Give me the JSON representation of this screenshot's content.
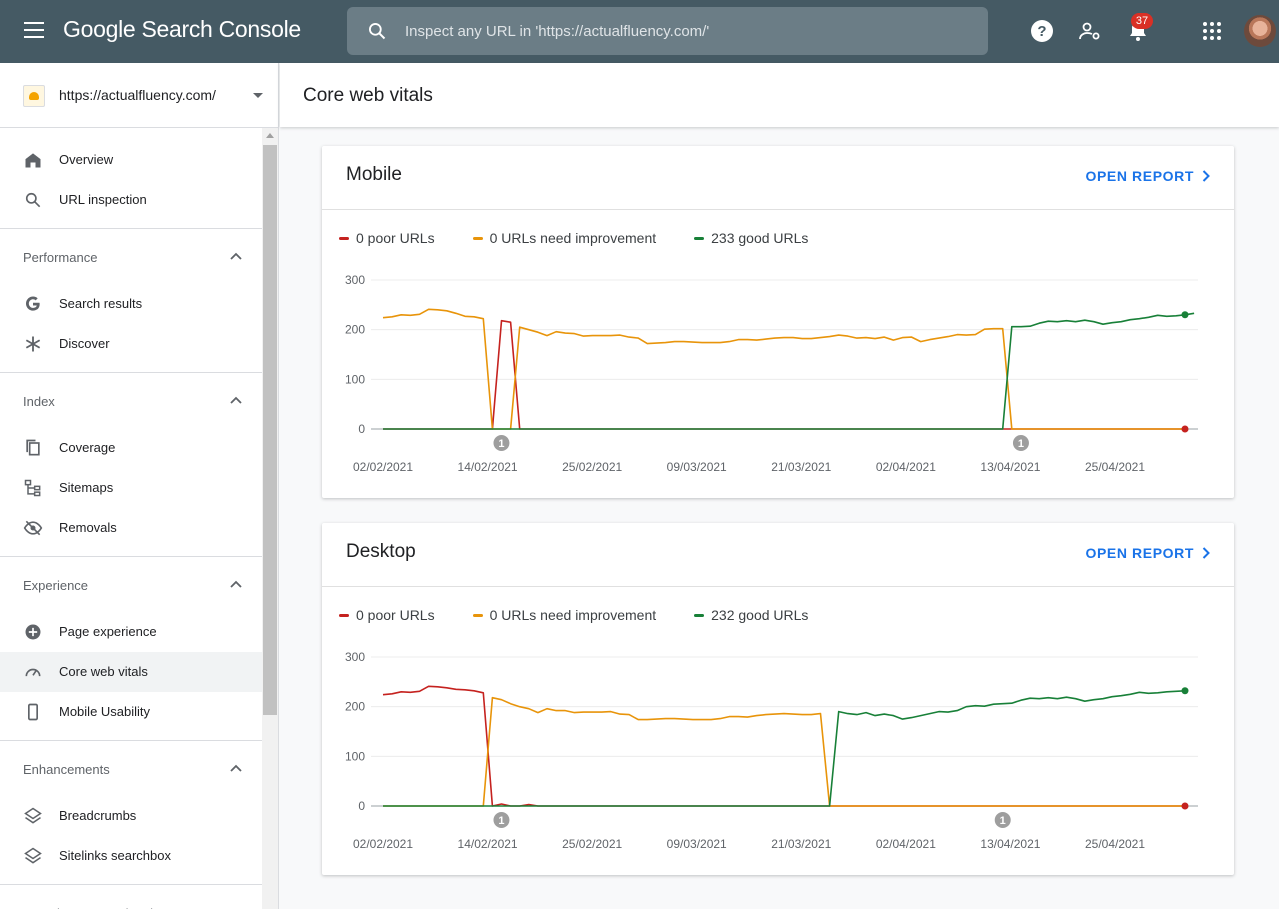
{
  "app": {
    "title": "Google Search Console",
    "search_placeholder": "Inspect any URL in 'https://actualfluency.com/'",
    "notifications_count": "37"
  },
  "property": {
    "url": "https://actualfluency.com/"
  },
  "sidebar": {
    "top_items": [
      {
        "label": "Overview",
        "icon": "home-icon"
      },
      {
        "label": "URL inspection",
        "icon": "search-icon"
      }
    ],
    "sections": [
      {
        "label": "Performance",
        "items": [
          {
            "label": "Search results",
            "icon": "google-g-icon"
          },
          {
            "label": "Discover",
            "icon": "asterisk-icon"
          }
        ]
      },
      {
        "label": "Index",
        "items": [
          {
            "label": "Coverage",
            "icon": "copy-icon"
          },
          {
            "label": "Sitemaps",
            "icon": "sitemap-icon"
          },
          {
            "label": "Removals",
            "icon": "eye-off-icon"
          }
        ]
      },
      {
        "label": "Experience",
        "items": [
          {
            "label": "Page experience",
            "icon": "plus-circle-icon"
          },
          {
            "label": "Core web vitals",
            "icon": "speedometer-icon",
            "active": true
          },
          {
            "label": "Mobile Usability",
            "icon": "phone-icon"
          }
        ]
      },
      {
        "label": "Enhancements",
        "items": [
          {
            "label": "Breadcrumbs",
            "icon": "layers-icon"
          },
          {
            "label": "Sitelinks searchbox",
            "icon": "layers-icon"
          }
        ]
      },
      {
        "label": "Security & Manual Actions",
        "items": [],
        "collapsed": true
      }
    ]
  },
  "page": {
    "title": "Core web vitals"
  },
  "cards": [
    {
      "title": "Mobile",
      "open_label": "OPEN REPORT",
      "legend": [
        "0 poor URLs",
        "0 URLs need improvement",
        "233 good URLs"
      ]
    },
    {
      "title": "Desktop",
      "open_label": "OPEN REPORT",
      "legend": [
        "0 poor URLs",
        "0 URLs need improvement",
        "232 good URLs"
      ]
    }
  ],
  "colors": {
    "poor": "#c5221f",
    "improve": "#e8940a",
    "good": "#188038",
    "accent": "#1a73e8",
    "topbar": "#455a64"
  },
  "chart_data": [
    {
      "type": "line",
      "title": "Mobile",
      "x_tick_labels": [
        "02/02/2021",
        "14/02/2021",
        "25/02/2021",
        "09/03/2021",
        "21/03/2021",
        "02/04/2021",
        "13/04/2021",
        "25/04/2021"
      ],
      "y_ticks": [
        0,
        100,
        200,
        300
      ],
      "ylim": [
        0,
        300
      ],
      "day_count": 89,
      "annotations": [
        {
          "day": 13,
          "label": "1"
        },
        {
          "day": 70,
          "label": "1"
        }
      ],
      "series": [
        {
          "name": "0 poor URLs",
          "color": "#c5221f",
          "values": [
            0,
            0,
            0,
            0,
            0,
            0,
            0,
            0,
            0,
            0,
            0,
            0,
            0,
            218,
            215,
            0,
            0,
            0,
            0,
            0,
            0,
            0,
            0,
            0,
            0,
            0,
            0,
            0,
            0,
            0,
            0,
            0,
            0,
            0,
            0,
            0,
            0,
            0,
            0,
            0,
            0,
            0,
            0,
            0,
            0,
            0,
            0,
            0,
            0,
            0,
            0,
            0,
            0,
            0,
            0,
            0,
            0,
            0,
            0,
            0,
            0,
            0,
            0,
            0,
            0,
            0,
            0,
            0,
            0,
            0,
            0,
            0,
            0,
            0,
            0,
            0,
            0,
            0,
            0,
            0,
            0,
            0,
            0,
            0,
            0,
            0,
            0,
            0,
            0
          ]
        },
        {
          "name": "0 URLs need improvement",
          "color": "#e8940a",
          "values": [
            224,
            226,
            230,
            229,
            231,
            241,
            240,
            238,
            233,
            227,
            226,
            222,
            0,
            0,
            0,
            205,
            200,
            195,
            188,
            196,
            193,
            192,
            187,
            188,
            188,
            188,
            189,
            185,
            183,
            172,
            173,
            174,
            176,
            176,
            175,
            174,
            174,
            174,
            176,
            180,
            180,
            179,
            181,
            183,
            184,
            184,
            182,
            182,
            184,
            186,
            189,
            187,
            183,
            184,
            182,
            185,
            179,
            184,
            185,
            176,
            180,
            183,
            186,
            190,
            189,
            190,
            201,
            202,
            202,
            0,
            0,
            0,
            0,
            0,
            0,
            0,
            0,
            0,
            0,
            0,
            0,
            0,
            0,
            0,
            0,
            0,
            0,
            0,
            0
          ]
        },
        {
          "name": "233 good URLs",
          "color": "#188038",
          "values": [
            0,
            0,
            0,
            0,
            0,
            0,
            0,
            0,
            0,
            0,
            0,
            0,
            0,
            0,
            0,
            0,
            0,
            0,
            0,
            0,
            0,
            0,
            0,
            0,
            0,
            0,
            0,
            0,
            0,
            0,
            0,
            0,
            0,
            0,
            0,
            0,
            0,
            0,
            0,
            0,
            0,
            0,
            0,
            0,
            0,
            0,
            0,
            0,
            0,
            0,
            0,
            0,
            0,
            0,
            0,
            0,
            0,
            0,
            0,
            0,
            0,
            0,
            0,
            0,
            0,
            0,
            0,
            0,
            0,
            206,
            206,
            207,
            213,
            217,
            216,
            218,
            216,
            219,
            216,
            211,
            214,
            216,
            220,
            222,
            225,
            229,
            227,
            228,
            230,
            233
          ]
        }
      ]
    },
    {
      "type": "line",
      "title": "Desktop",
      "x_tick_labels": [
        "02/02/2021",
        "14/02/2021",
        "25/02/2021",
        "09/03/2021",
        "21/03/2021",
        "02/04/2021",
        "13/04/2021",
        "25/04/2021"
      ],
      "y_ticks": [
        0,
        100,
        200,
        300
      ],
      "ylim": [
        0,
        300
      ],
      "day_count": 89,
      "annotations": [
        {
          "day": 13,
          "label": "1"
        },
        {
          "day": 68,
          "label": "1"
        }
      ],
      "series": [
        {
          "name": "0 poor URLs",
          "color": "#c5221f",
          "values": [
            224,
            226,
            230,
            229,
            231,
            241,
            240,
            238,
            235,
            234,
            232,
            228,
            0,
            4,
            0,
            0,
            3,
            0,
            0,
            0,
            0,
            0,
            0,
            0,
            0,
            0,
            0,
            0,
            0,
            0,
            0,
            0,
            0,
            0,
            0,
            0,
            0,
            0,
            0,
            0,
            0,
            0,
            0,
            0,
            0,
            0,
            0,
            0,
            0,
            0,
            0,
            0,
            0,
            0,
            0,
            0,
            0,
            0,
            0,
            0,
            0,
            0,
            0,
            0,
            0,
            0,
            0,
            0,
            0,
            0,
            0,
            0,
            0,
            0,
            0,
            0,
            0,
            0,
            0,
            0,
            0,
            0,
            0,
            0,
            0,
            0,
            0,
            0,
            0
          ]
        },
        {
          "name": "0 URLs need improvement",
          "color": "#e8940a",
          "values": [
            0,
            0,
            0,
            0,
            0,
            0,
            0,
            0,
            0,
            0,
            0,
            0,
            218,
            214,
            206,
            200,
            196,
            188,
            196,
            192,
            192,
            188,
            189,
            189,
            189,
            190,
            185,
            184,
            174,
            174,
            175,
            176,
            176,
            175,
            174,
            174,
            174,
            176,
            180,
            180,
            179,
            182,
            184,
            185,
            186,
            185,
            184,
            184,
            186,
            0,
            0,
            0,
            0,
            0,
            0,
            0,
            0,
            0,
            0,
            0,
            0,
            0,
            0,
            0,
            0,
            0,
            0,
            0,
            0,
            0,
            0,
            0,
            0,
            0,
            0,
            0,
            0,
            0,
            0,
            0,
            0,
            0,
            0,
            0,
            0,
            0,
            0,
            0,
            0
          ]
        },
        {
          "name": "232 good URLs",
          "color": "#188038",
          "values": [
            0,
            0,
            0,
            0,
            0,
            0,
            0,
            0,
            0,
            0,
            0,
            0,
            0,
            0,
            0,
            0,
            0,
            0,
            0,
            0,
            0,
            0,
            0,
            0,
            0,
            0,
            0,
            0,
            0,
            0,
            0,
            0,
            0,
            0,
            0,
            0,
            0,
            0,
            0,
            0,
            0,
            0,
            0,
            0,
            0,
            0,
            0,
            0,
            0,
            0,
            190,
            186,
            184,
            188,
            182,
            185,
            182,
            175,
            178,
            182,
            186,
            190,
            189,
            192,
            200,
            202,
            201,
            205,
            206,
            207,
            213,
            217,
            216,
            218,
            216,
            219,
            216,
            211,
            214,
            216,
            220,
            222,
            225,
            229,
            227,
            228,
            230,
            231,
            232
          ]
        }
      ]
    }
  ]
}
